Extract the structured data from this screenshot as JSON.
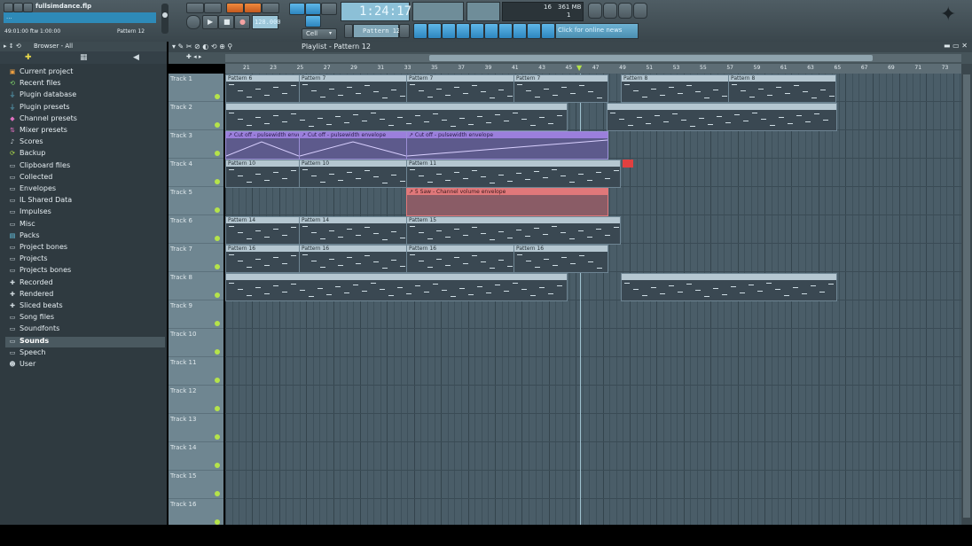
{
  "toolbar": {
    "filename": "fullsimdance.flp",
    "hint": "...",
    "status_time": "49:01:00 ftw  1:00:00",
    "pattern_selector": "Pattern 12",
    "time_display": "1:24:17",
    "snap_label": "Cell",
    "tempo": "128.000",
    "cpu_value": "16",
    "ram_value": "361 MB",
    "poly_value": "1",
    "news_text": "Click for online news",
    "pattern_box": "Pattern 12"
  },
  "browser": {
    "header_label": "Browser - All",
    "items": [
      {
        "label": "Current project",
        "icon": "project-icon",
        "selected": false
      },
      {
        "label": "Recent files",
        "icon": "recent-icon",
        "selected": false
      },
      {
        "label": "Plugin database",
        "icon": "plug-icon",
        "selected": false
      },
      {
        "label": "Plugin presets",
        "icon": "plug-icon",
        "selected": false
      },
      {
        "label": "Channel presets",
        "icon": "channel-icon",
        "selected": false
      },
      {
        "label": "Mixer presets",
        "icon": "mixer-icon",
        "selected": false
      },
      {
        "label": "Scores",
        "icon": "note-icon",
        "selected": false
      },
      {
        "label": "Backup",
        "icon": "backup-icon",
        "selected": false
      },
      {
        "label": "Clipboard files",
        "icon": "folder-icon",
        "selected": false
      },
      {
        "label": "Collected",
        "icon": "folder-icon",
        "selected": false
      },
      {
        "label": "Envelopes",
        "icon": "folder-icon",
        "selected": false
      },
      {
        "label": "IL Shared Data",
        "icon": "folder-icon",
        "selected": false
      },
      {
        "label": "Impulses",
        "icon": "folder-icon",
        "selected": false
      },
      {
        "label": "Misc",
        "icon": "folder-icon",
        "selected": false
      },
      {
        "label": "Packs",
        "icon": "packs-icon",
        "selected": false
      },
      {
        "label": "Project bones",
        "icon": "folder-icon",
        "selected": false
      },
      {
        "label": "Projects",
        "icon": "folder-icon",
        "selected": false
      },
      {
        "label": "Projects bones",
        "icon": "folder-icon",
        "selected": false
      },
      {
        "label": "Recorded",
        "icon": "plus-icon",
        "selected": false
      },
      {
        "label": "Rendered",
        "icon": "plus-icon",
        "selected": false
      },
      {
        "label": "Sliced beats",
        "icon": "plus-icon",
        "selected": false
      },
      {
        "label": "Song files",
        "icon": "folder-icon",
        "selected": false
      },
      {
        "label": "Soundfonts",
        "icon": "folder-icon",
        "selected": false
      },
      {
        "label": "Sounds",
        "icon": "folder-icon",
        "selected": true
      },
      {
        "label": "Speech",
        "icon": "folder-icon",
        "selected": false
      },
      {
        "label": "User",
        "icon": "user-icon",
        "selected": false
      }
    ]
  },
  "playlist": {
    "title": "Playlist - Pattern 12",
    "ruler_marks": [
      "21",
      "23",
      "25",
      "27",
      "29",
      "31",
      "33",
      "35",
      "37",
      "39",
      "41",
      "43",
      "45",
      "47",
      "49",
      "51",
      "53",
      "55",
      "57",
      "59",
      "61",
      "63",
      "65",
      "67",
      "69",
      "71",
      "73"
    ],
    "tracks": [
      "Track 1",
      "Track 2",
      "Track 3",
      "Track 4",
      "Track 5",
      "Track 6",
      "Track 7",
      "Track 8",
      "Track 9",
      "Track 10",
      "Track 11",
      "Track 12",
      "Track 13",
      "Track 14",
      "Track 15",
      "Track 16"
    ],
    "clip_labels": {
      "p6": "Pattern 6",
      "p7": "Pattern 7",
      "p8": "Pattern 8",
      "p10": "Pattern 10",
      "p11": "Pattern 11",
      "p14": "Pattern 14",
      "p15": "Pattern 15",
      "p16": "Pattern 16",
      "auto1": "↗ Cut off - pulsewidth envelope",
      "auto2": "↗ Cut off - pulsewidth envelope",
      "auto3": "↗ Cut off - pulsewidth envelope",
      "auto4": "↗ 5 Saw - Channel volume envelope"
    }
  },
  "colors": {
    "accent_green": "#b5e34a",
    "automation_purple": "#9b7fdc",
    "automation_red": "#e0787a",
    "grid_bg": "#4a5d68"
  }
}
